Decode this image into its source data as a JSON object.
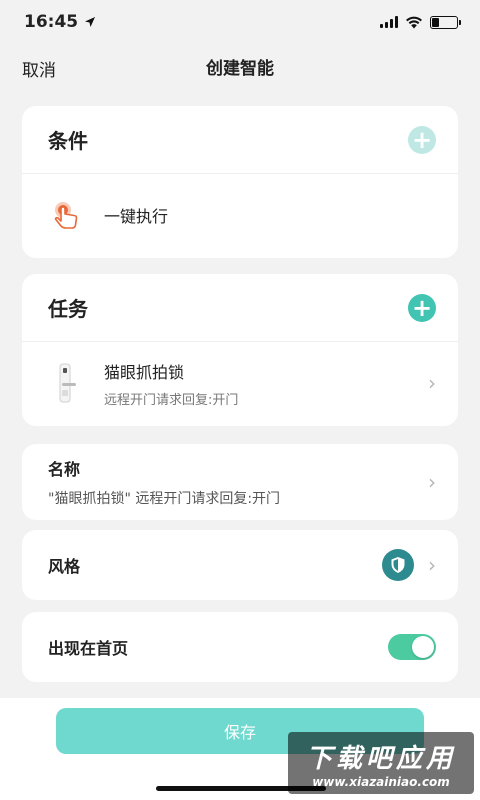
{
  "status_bar": {
    "time": "16:45",
    "location_icon": "location-arrow-icon",
    "signal_icon": "cellular-signal-icon",
    "wifi_icon": "wifi-icon",
    "battery_icon": "battery-icon"
  },
  "nav": {
    "cancel_label": "取消",
    "title": "创建智能"
  },
  "condition": {
    "header": "条件",
    "add_icon": "plus-icon",
    "item_label": "一键执行",
    "item_icon": "tap-hand-icon"
  },
  "task": {
    "header": "任务",
    "add_icon": "plus-icon",
    "item_title": "猫眼抓拍锁",
    "item_subtitle": "远程开门请求回复:开门",
    "item_icon": "door-lock-icon"
  },
  "name_section": {
    "label": "名称",
    "value": "\"猫眼抓拍锁\" 远程开门请求回复:开门"
  },
  "style_section": {
    "label": "风格",
    "badge_icon": "shield-icon"
  },
  "homepage_section": {
    "label": "出现在首页",
    "toggle_on": true
  },
  "bottom": {
    "save_label": "保存"
  },
  "watermark": {
    "line1": "下载吧应用",
    "line2": "www.xiazainiao.com"
  },
  "colors": {
    "accent": "#42c4b3",
    "accent_light": "#bfe8e4",
    "toggle": "#4ccaa0",
    "save_button": "#6fd9d0",
    "badge": "#2d8a8e"
  }
}
